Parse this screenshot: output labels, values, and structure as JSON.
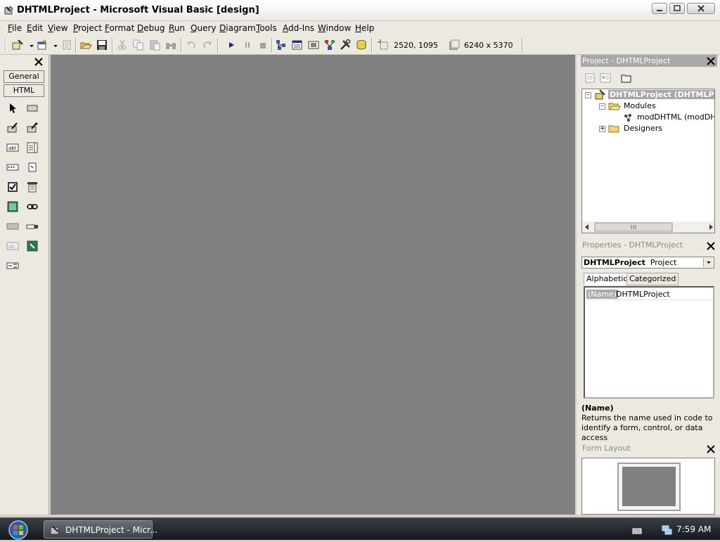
{
  "window": {
    "title": "DHTMLProject - Microsoft Visual Basic [design]"
  },
  "menu": [
    "File",
    "Edit",
    "View",
    "Project",
    "Format",
    "Debug",
    "Run",
    "Query",
    "Diagram",
    "Tools",
    "Add-Ins",
    "Window",
    "Help"
  ],
  "toolbar": {
    "position_readout": "2520, 1095",
    "size_readout": "6240 x 5370"
  },
  "toolbox": {
    "tabs": [
      "General",
      "HTML"
    ]
  },
  "project_explorer": {
    "title": "Project - DHTMLProject",
    "tree": {
      "root": "DHTMLProject (DHTMLProject)",
      "modules": "Modules",
      "module_item": "modDHTML (modDHTML)",
      "designers": "Designers"
    }
  },
  "properties": {
    "title": "Properties - DHTMLProject",
    "object_name": "DHTMLProject",
    "object_type": "Project",
    "tabs": [
      "Alphabetic",
      "Categorized"
    ],
    "rows": [
      {
        "name": "(Name)",
        "value": "DHTMLProject"
      }
    ],
    "description_title": "(Name)",
    "description_text": "Returns the name used in code to identify a form, control, or data access"
  },
  "form_layout": {
    "title": "Form Layout"
  },
  "taskbar": {
    "task_label": "DHTMLProject - Micr...",
    "clock": "7:59 AM"
  }
}
